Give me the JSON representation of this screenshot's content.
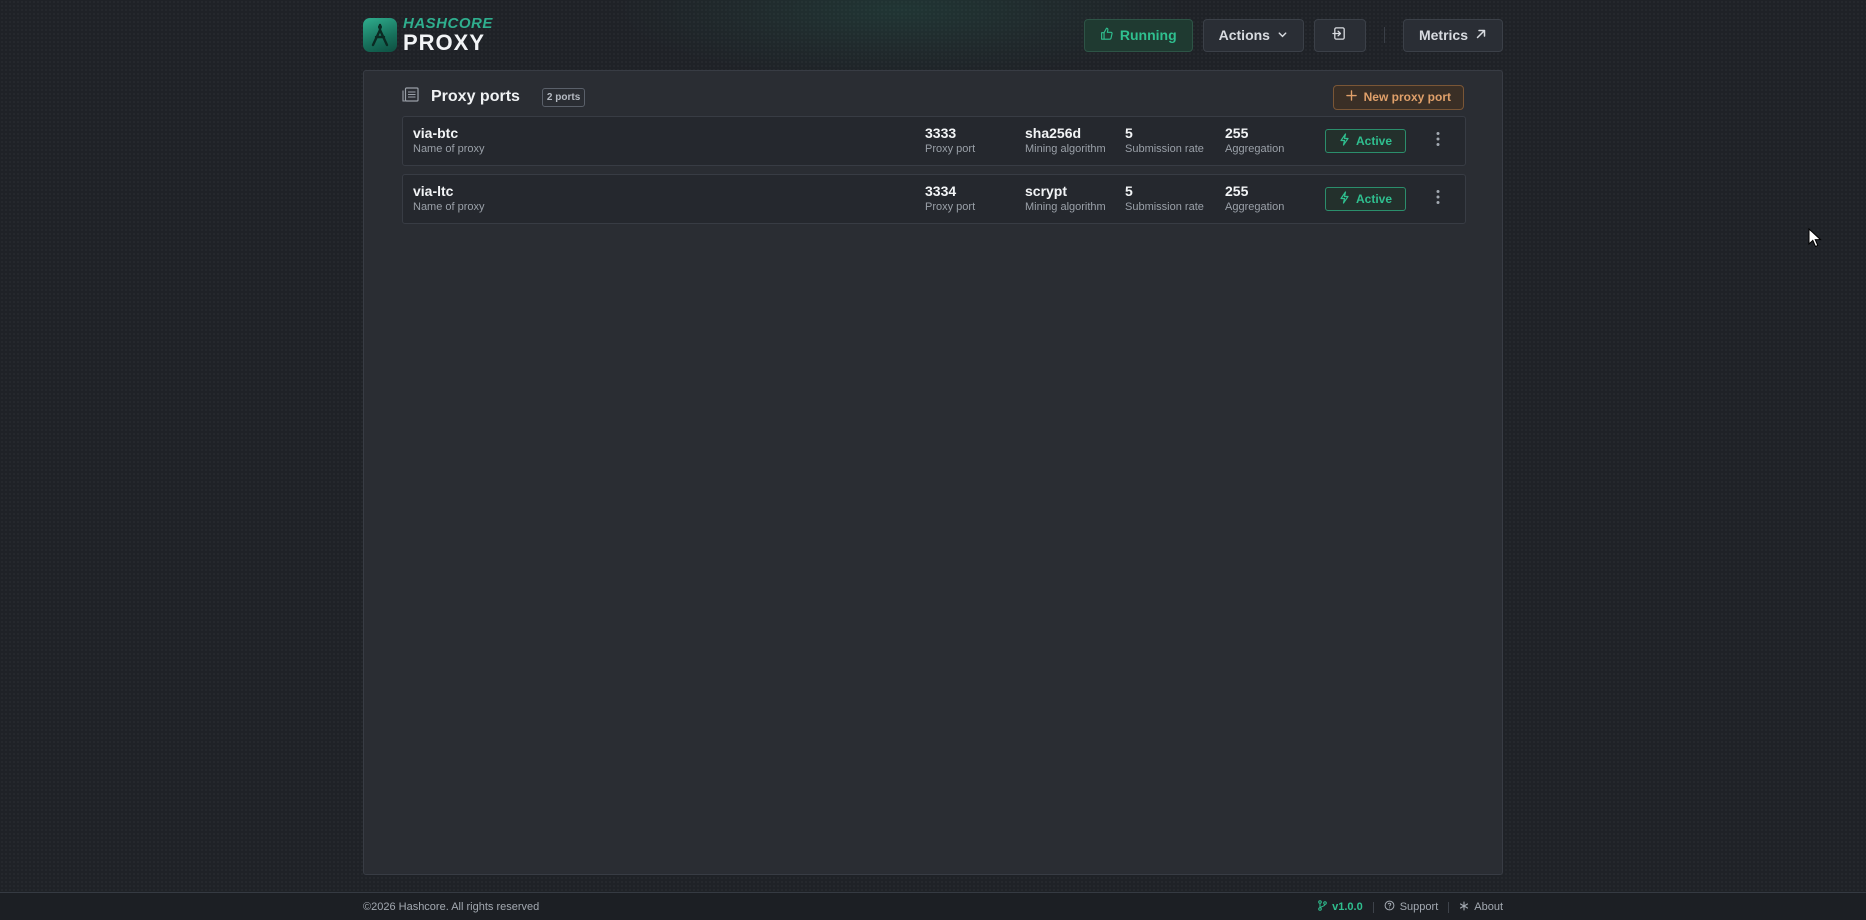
{
  "brand": {
    "top": "HASHCORE",
    "bottom": "PROXY"
  },
  "header": {
    "status_label": "Running",
    "actions_label": "Actions",
    "metrics_label": "Metrics"
  },
  "panel": {
    "title": "Proxy ports",
    "count_badge": "2 ports",
    "new_button_label": "New proxy port"
  },
  "rows": [
    {
      "name": "via-btc",
      "name_label": "Name of proxy",
      "port": "3333",
      "port_label": "Proxy port",
      "algorithm": "sha256d",
      "algorithm_label": "Mining algorithm",
      "rate": "5",
      "rate_label": "Submission rate",
      "aggregation": "255",
      "aggregation_label": "Aggregation",
      "status": "Active"
    },
    {
      "name": "via-ltc",
      "name_label": "Name of proxy",
      "port": "3334",
      "port_label": "Proxy port",
      "algorithm": "scrypt",
      "algorithm_label": "Mining algorithm",
      "rate": "5",
      "rate_label": "Submission rate",
      "aggregation": "255",
      "aggregation_label": "Aggregation",
      "status": "Active"
    }
  ],
  "footer": {
    "copyright": "©2026 Hashcore. All rights reserved",
    "version": "v1.0.0",
    "support": "Support",
    "about": "About"
  },
  "colors": {
    "accent_green": "#2fbf8f",
    "accent_orange": "#e0a06a",
    "background": "#1f2227",
    "panel": "#2a2d33"
  }
}
